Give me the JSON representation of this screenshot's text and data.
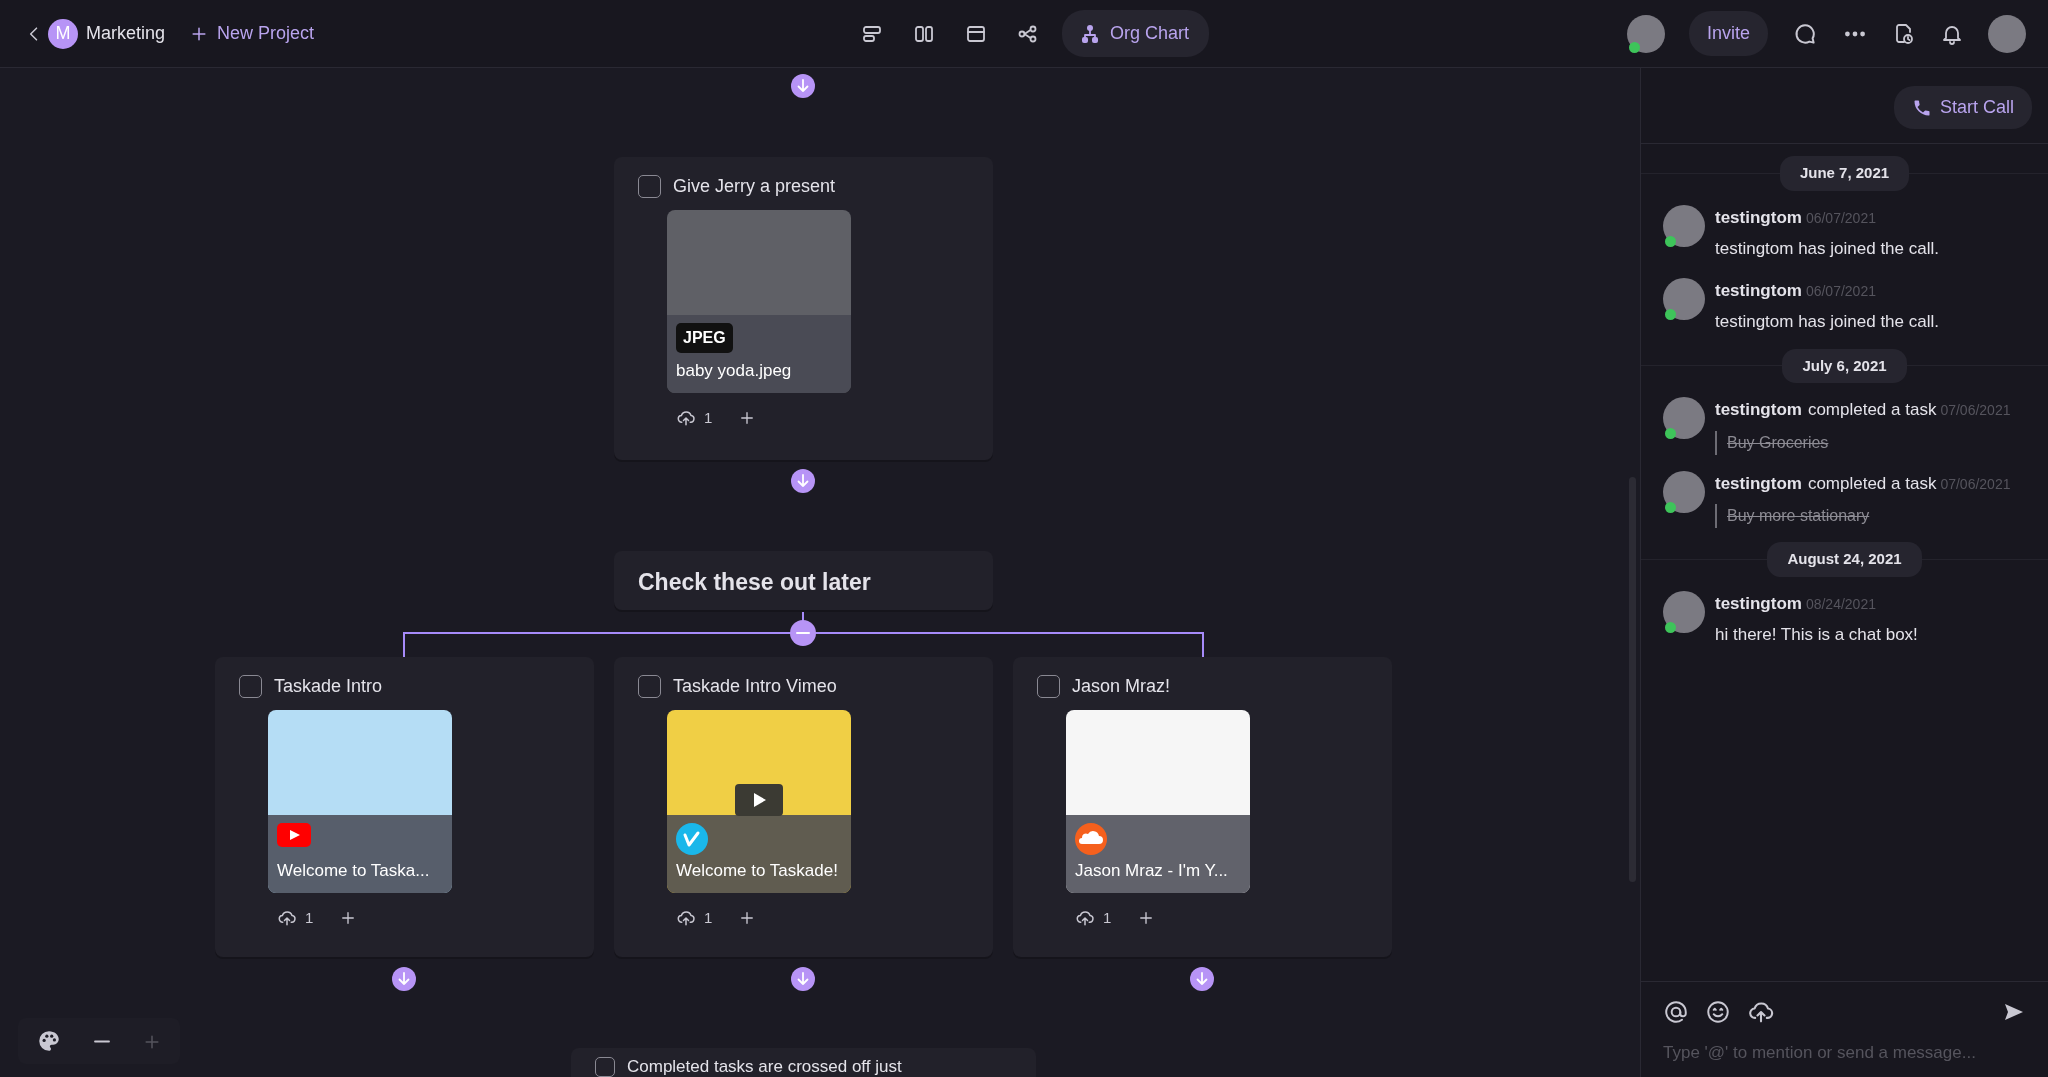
{
  "topbar": {
    "workspace": {
      "initial": "M",
      "name": "Marketing"
    },
    "new_project": "New Project",
    "views": [
      {
        "kind": "list",
        "selected": false
      },
      {
        "kind": "columns",
        "selected": false
      },
      {
        "kind": "board",
        "selected": false
      },
      {
        "kind": "mindmap",
        "selected": false
      },
      {
        "kind": "org",
        "label": "Org Chart",
        "selected": true
      }
    ],
    "member_online": true,
    "invite": "Invite"
  },
  "canvas": {
    "nodes": [
      {
        "kind": "task",
        "title": "Give Jerry a present",
        "checked": false,
        "attachment": {
          "kind": "image",
          "badge": "JPEG",
          "caption": "baby yoda.jpeg"
        },
        "uploads": "1"
      },
      {
        "kind": "section",
        "title": "Check these out later",
        "expanded": true,
        "children": [
          {
            "kind": "task",
            "title": "Taskade Intro",
            "checked": false,
            "attachment": {
              "kind": "youtube",
              "caption": "Welcome to Taska..."
            },
            "uploads": "1"
          },
          {
            "kind": "task",
            "title": "Taskade Intro Vimeo",
            "checked": false,
            "attachment": {
              "kind": "vimeo",
              "caption": "Welcome to Taskade!"
            },
            "uploads": "1"
          },
          {
            "kind": "task",
            "title": "Jason Mraz!",
            "checked": false,
            "attachment": {
              "kind": "soundcloud",
              "caption": "Jason Mraz - I'm Y..."
            },
            "uploads": "1"
          }
        ]
      },
      {
        "kind": "task",
        "title": "Completed tasks are crossed off just",
        "checked": false
      }
    ]
  },
  "chat": {
    "start_call": "Start Call",
    "days": [
      {
        "date": "June 7, 2021",
        "messages": [
          {
            "kind": "text",
            "author": "testingtom",
            "online": true,
            "time": "06/07/2021",
            "text": "testingtom has joined the call."
          },
          {
            "kind": "text",
            "author": "testingtom",
            "online": true,
            "time": "06/07/2021",
            "text": "testingtom has joined the call."
          }
        ]
      },
      {
        "date": "July 6, 2021",
        "messages": [
          {
            "kind": "task",
            "author": "testingtom",
            "online": true,
            "action": "completed a task",
            "time": "07/06/2021",
            "task": "Buy Groceries"
          },
          {
            "kind": "task",
            "author": "testingtom",
            "online": true,
            "action": "completed a task",
            "time": "07/06/2021",
            "task": "Buy more stationary"
          }
        ]
      },
      {
        "date": "August 24, 2021",
        "messages": [
          {
            "kind": "text",
            "author": "testingtom",
            "online": true,
            "time": "08/24/2021",
            "text": "hi there! This is a chat box!"
          }
        ]
      }
    ],
    "composer": {
      "placeholder": "Type '@' to mention or send a message..."
    }
  }
}
